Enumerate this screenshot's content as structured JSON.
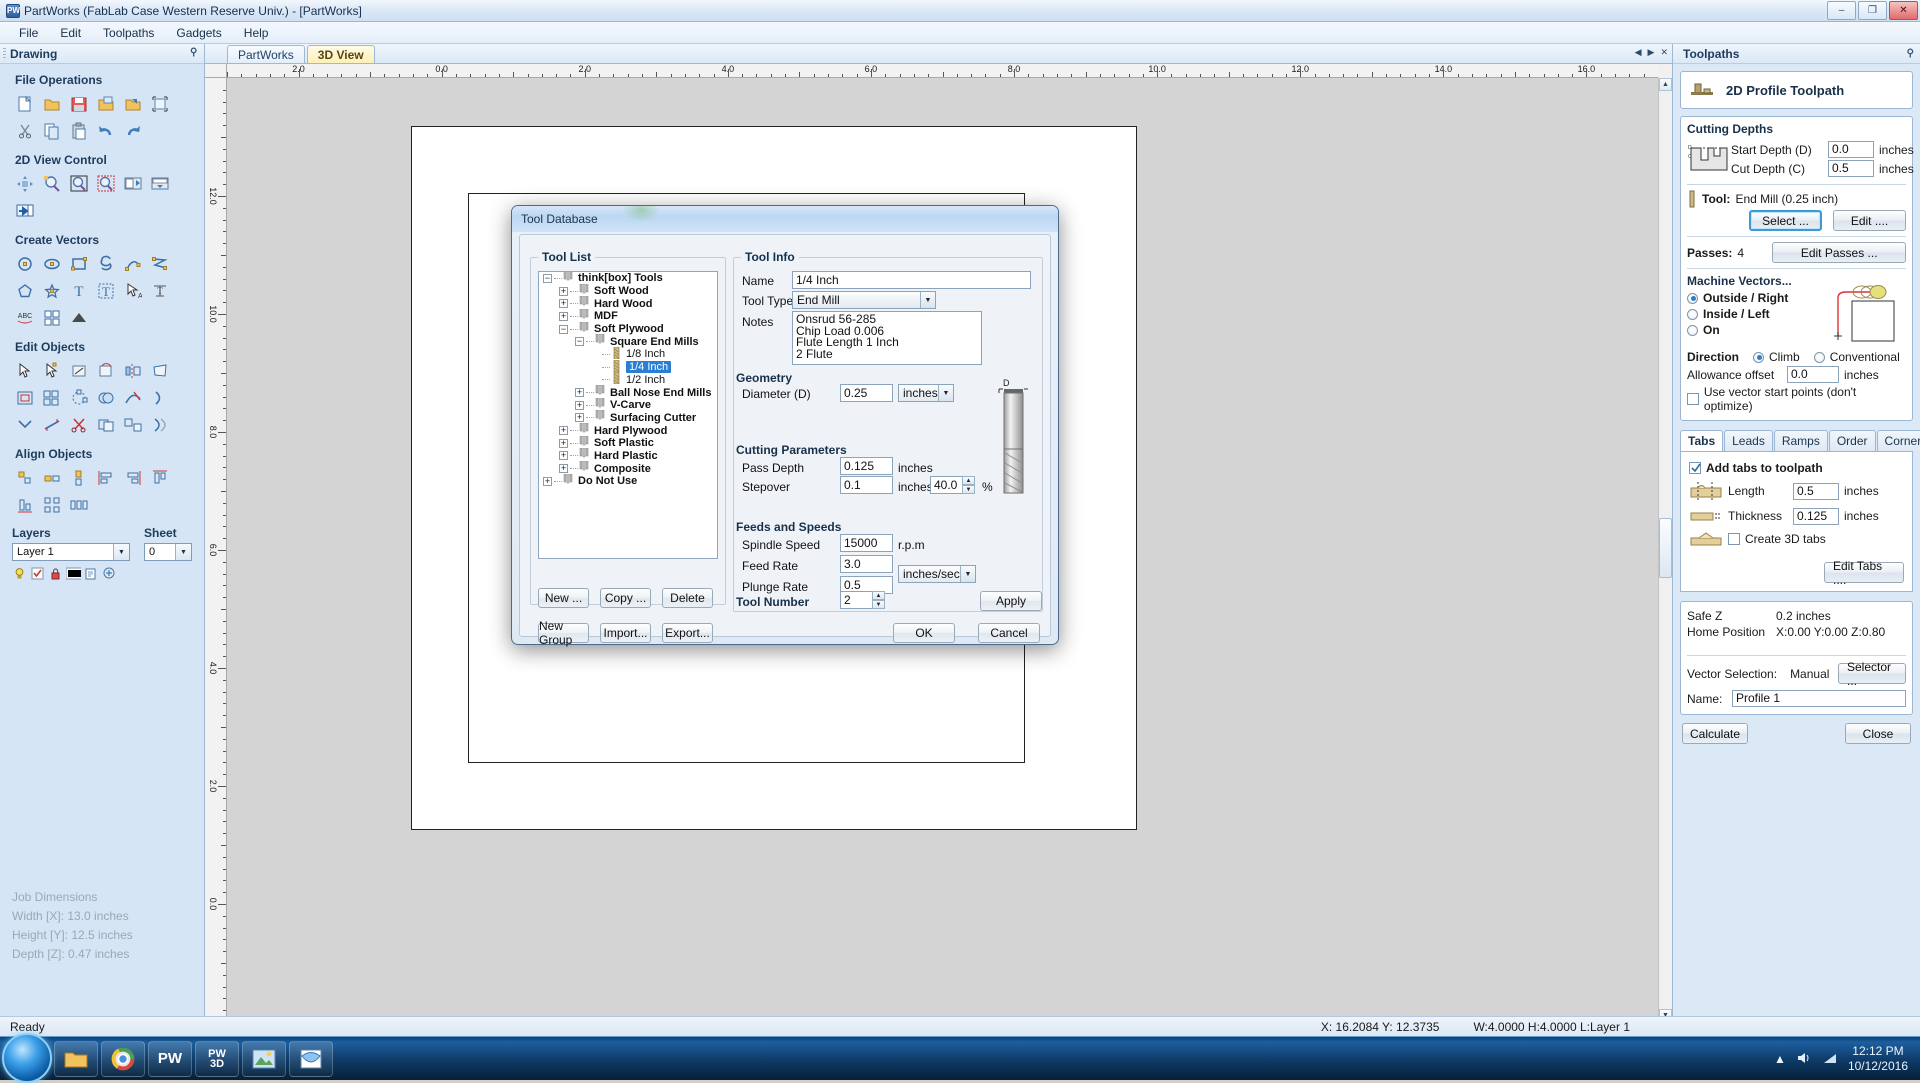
{
  "window": {
    "title": "PartWorks (FabLab Case Western Reserve Univ.) - [PartWorks]",
    "ghost_title": "PartWorks",
    "minimize": "–",
    "maximize": "❐",
    "close": "✕"
  },
  "menu": [
    "File",
    "Edit",
    "Toolpaths",
    "Gadgets",
    "Help"
  ],
  "left_dock": {
    "header": "Drawing",
    "groups": [
      {
        "title": "File Operations",
        "icons": [
          "new-file-icon",
          "open-folder-icon",
          "save-icon",
          "open-recent-icon",
          "import-icon",
          "select-all-icon",
          "cut-icon",
          "copy-icon",
          "paste-icon",
          "undo-icon",
          "redo-icon"
        ]
      },
      {
        "title": "2D View Control",
        "icons": [
          "pan-icon",
          "zoom-window-icon",
          "zoom-extents-icon",
          "zoom-selection-icon",
          "view-2d-icon",
          "view-split-icon",
          "view-toggle-icon"
        ]
      },
      {
        "title": "Create Vectors",
        "icons": [
          "circle-icon",
          "ellipse-icon",
          "rectangle-icon",
          "polyline-icon",
          "arc-icon",
          "curve-icon",
          "polygon-icon",
          "star-icon",
          "text-icon",
          "text-box-icon",
          "text-select-icon",
          "text-on-curve-icon",
          "text-arc-icon",
          "dimension-icon",
          "trace-bitmap-icon"
        ]
      },
      {
        "title": "Edit Objects",
        "icons": [
          "node-edit-icon",
          "move-icon",
          "scale-icon",
          "rotate-icon",
          "mirror-icon",
          "distort-icon",
          "offset-icon",
          "array-copy-icon",
          "rotate-copy-icon",
          "weld-icon",
          "trim-icon",
          "join-icon",
          "fillet-icon",
          "measure-icon",
          "scissors-icon",
          "group-icon",
          "ungroup-icon",
          "nest-icon"
        ]
      },
      {
        "title": "Align Objects",
        "icons": [
          "align-center-icon",
          "align-h-icon",
          "align-v-icon",
          "align-left-icon",
          "align-right-icon",
          "align-top-icon",
          "align-bottom-icon",
          "align-grid-icon",
          "align-spread-icon"
        ]
      }
    ],
    "layers": {
      "title": "Layers",
      "value": "Layer 1"
    },
    "sheet": {
      "title": "Sheet",
      "value": "0"
    },
    "job_dimensions": {
      "title": "Job Dimensions",
      "width": "Width  [X]: 13.0 inches",
      "height": "Height [Y]: 12.5 inches",
      "depth": "Depth  [Z]: 0.47 inches"
    }
  },
  "center": {
    "tabs": [
      {
        "label": "PartWorks",
        "active": false
      },
      {
        "label": "3D View",
        "active": true
      }
    ],
    "nav": [
      "◀",
      "▶",
      "✕"
    ],
    "ruler_top_labels": [
      "2.0",
      "0.0",
      "2.0",
      "4.0",
      "6.0",
      "8.0",
      "10.0",
      "12.0",
      "14.0",
      "16.0"
    ],
    "ruler_left_labels": [
      "12.0",
      "10.0",
      "8.0",
      "6.0",
      "4.0",
      "2.0",
      "0.0"
    ]
  },
  "toolpaths": {
    "header": "Toolpaths",
    "pin": "⚲",
    "toolpath_name": "2D Profile Toolpath",
    "cutting_depths": {
      "title": "Cutting Depths",
      "start_depth_label": "Start Depth (D)",
      "start_depth_value": "0.0",
      "start_depth_unit": "inches",
      "cut_depth_label": "Cut Depth (C)",
      "cut_depth_value": "0.5",
      "cut_depth_unit": "inches"
    },
    "tool": {
      "label": "Tool:",
      "value": "End Mill (0.25 inch)",
      "select_button": "Select ...",
      "edit_button": "Edit ...."
    },
    "passes": {
      "label": "Passes:",
      "value": "4",
      "edit_button": "Edit Passes ..."
    },
    "machine_vectors": {
      "title": "Machine Vectors...",
      "options": [
        {
          "label": "Outside / Right",
          "selected": true
        },
        {
          "label": "Inside / Left",
          "selected": false
        },
        {
          "label": "On",
          "selected": false
        }
      ],
      "direction_label": "Direction",
      "direction_options": [
        {
          "label": "Climb",
          "selected": true
        },
        {
          "label": "Conventional",
          "selected": false
        }
      ],
      "allowance_label": "Allowance offset",
      "allowance_value": "0.0",
      "allowance_unit": "inches",
      "start_points_label": "Use vector start points (don't optimize)",
      "start_points_checked": false
    },
    "tabs": [
      {
        "label": "Tabs",
        "active": true
      },
      {
        "label": "Leads",
        "active": false
      },
      {
        "label": "Ramps",
        "active": false
      },
      {
        "label": "Order",
        "active": false
      },
      {
        "label": "Corners",
        "active": false
      }
    ],
    "tabs_panel": {
      "add_tabs_label": "Add tabs to toolpath",
      "add_tabs_checked": true,
      "length_label": "Length",
      "length_value": "0.5",
      "length_unit": "inches",
      "thickness_label": "Thickness",
      "thickness_value": "0.125",
      "thickness_unit": "inches",
      "create_3d_label": "Create 3D tabs",
      "create_3d_checked": false,
      "edit_tabs_button": "Edit Tabs ...."
    },
    "summary": {
      "safe_z_label": "Safe Z",
      "safe_z_value": "0.2 inches",
      "home_label": "Home Position",
      "home_value": "X:0.00 Y:0.00 Z:0.80",
      "vector_selection_label": "Vector Selection:",
      "vector_selection_value": "Manual",
      "selector_button": "Selector ...",
      "name_label": "Name:",
      "name_value": "Profile 1"
    },
    "calculate_button": "Calculate",
    "close_button": "Close"
  },
  "status": {
    "ready": "Ready",
    "coords": "X: 16.2084 Y: 12.3735",
    "dims": "W:4.0000  H:4.0000  L:Layer 1"
  },
  "taskbar": {
    "buttons": [
      "folder-icon",
      "chrome-icon",
      "pw-icon",
      "pw3d-icon",
      "image-icon",
      "browser-icon"
    ],
    "tray_icons": [
      "chevron-up-icon",
      "speaker-icon",
      "network-icon"
    ],
    "time": "12:12 PM",
    "date": "10/12/2016"
  },
  "dialog": {
    "title": "Tool Database",
    "tool_list_label": "Tool List",
    "tree": [
      {
        "label": "think[box] Tools",
        "depth": 0,
        "toggle": "minus",
        "bold": true,
        "icon": "mill-group-icon",
        "selected": false
      },
      {
        "label": "Soft Wood",
        "depth": 1,
        "toggle": "plus",
        "bold": true,
        "icon": "mill-group-icon",
        "selected": false
      },
      {
        "label": "Hard Wood",
        "depth": 1,
        "toggle": "plus",
        "bold": true,
        "icon": "mill-group-icon",
        "selected": false
      },
      {
        "label": "MDF",
        "depth": 1,
        "toggle": "plus",
        "bold": true,
        "icon": "mill-group-icon",
        "selected": false
      },
      {
        "label": "Soft Plywood",
        "depth": 1,
        "toggle": "minus",
        "bold": true,
        "icon": "mill-group-icon",
        "selected": false
      },
      {
        "label": "Square End Mills",
        "depth": 2,
        "toggle": "minus",
        "bold": true,
        "icon": "mill-group-icon",
        "selected": false
      },
      {
        "label": "1/8 Inch",
        "depth": 3,
        "toggle": "none",
        "bold": false,
        "icon": "end-mill-icon",
        "selected": false
      },
      {
        "label": "1/4 Inch",
        "depth": 3,
        "toggle": "none",
        "bold": false,
        "icon": "end-mill-icon",
        "selected": true
      },
      {
        "label": "1/2 Inch",
        "depth": 3,
        "toggle": "none",
        "bold": false,
        "icon": "end-mill-icon",
        "selected": false
      },
      {
        "label": "Ball Nose End Mills",
        "depth": 2,
        "toggle": "plus",
        "bold": true,
        "icon": "mill-group-icon",
        "selected": false
      },
      {
        "label": "V-Carve",
        "depth": 2,
        "toggle": "plus",
        "bold": true,
        "icon": "mill-group-icon",
        "selected": false
      },
      {
        "label": "Surfacing Cutter",
        "depth": 2,
        "toggle": "plus",
        "bold": true,
        "icon": "mill-group-icon",
        "selected": false
      },
      {
        "label": "Hard Plywood",
        "depth": 1,
        "toggle": "plus",
        "bold": true,
        "icon": "mill-group-icon",
        "selected": false
      },
      {
        "label": "Soft Plastic",
        "depth": 1,
        "toggle": "plus",
        "bold": true,
        "icon": "mill-group-icon",
        "selected": false
      },
      {
        "label": "Hard Plastic",
        "depth": 1,
        "toggle": "plus",
        "bold": true,
        "icon": "mill-group-icon",
        "selected": false
      },
      {
        "label": "Composite",
        "depth": 1,
        "toggle": "plus",
        "bold": true,
        "icon": "mill-group-icon",
        "selected": false
      },
      {
        "label": "Do Not Use",
        "depth": 0,
        "toggle": "plus",
        "bold": true,
        "icon": "mill-group-icon",
        "selected": false
      }
    ],
    "list_buttons": [
      "New ...",
      "Copy ...",
      "Delete"
    ],
    "list_buttons2": [
      "New Group",
      "Import...",
      "Export..."
    ],
    "tool_info": {
      "title": "Tool Info",
      "name_label": "Name",
      "name_value": "1/4 Inch",
      "tool_type_label": "Tool Type",
      "tool_type_value": "End Mill",
      "notes_label": "Notes",
      "notes_value": "Onsrud 56-285\nChip Load 0.006\nFlute Length 1 Inch\n2 Flute"
    },
    "geometry": {
      "title": "Geometry",
      "diameter_label": "Diameter (D)",
      "diameter_value": "0.25",
      "diameter_unit": "inches"
    },
    "cutting_parameters": {
      "title": "Cutting Parameters",
      "pass_depth_label": "Pass Depth",
      "pass_depth_value": "0.125",
      "pass_depth_unit": "inches",
      "stepover_label": "Stepover",
      "stepover_value": "0.1",
      "stepover_unit": "inches",
      "stepover_pct_value": "40.0",
      "stepover_pct_unit": "%"
    },
    "feeds_and_speeds": {
      "title": "Feeds and Speeds",
      "spindle_label": "Spindle Speed",
      "spindle_value": "15000",
      "spindle_unit": "r.p.m",
      "feed_label": "Feed Rate",
      "feed_value": "3.0",
      "feed_unit": "inches/sec",
      "plunge_label": "Plunge Rate",
      "plunge_value": "0.5"
    },
    "tool_number": {
      "label": "Tool Number",
      "value": "2"
    },
    "apply_button": "Apply",
    "ok_button": "OK",
    "cancel_button": "Cancel",
    "preview_label": "D"
  }
}
